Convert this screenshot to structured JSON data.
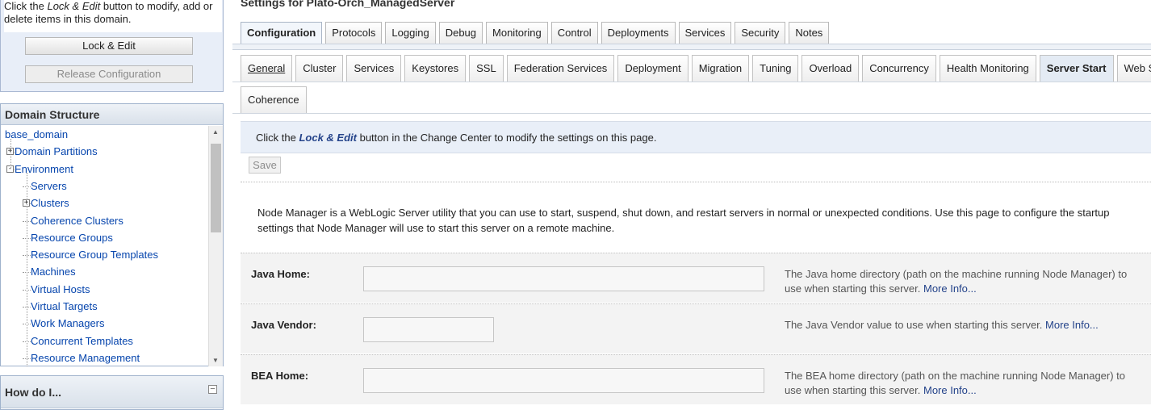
{
  "change_center": {
    "message_prefix": "Click the ",
    "message_emph": "Lock & Edit",
    "message_suffix": " button to modify, add or delete items in this domain.",
    "lock_edit_label": "Lock & Edit",
    "release_config_label": "Release Configuration"
  },
  "domain_structure": {
    "title": "Domain Structure",
    "tree": [
      {
        "label": "base_domain",
        "level": 0,
        "toggle": ""
      },
      {
        "label": "Domain Partitions",
        "level": 1,
        "toggle": "+"
      },
      {
        "label": "Environment",
        "level": 1,
        "toggle": "-"
      },
      {
        "label": "Servers",
        "level": 2,
        "toggle": ""
      },
      {
        "label": "Clusters",
        "level": 2,
        "toggle": "+"
      },
      {
        "label": "Coherence Clusters",
        "level": 2,
        "toggle": ""
      },
      {
        "label": "Resource Groups",
        "level": 2,
        "toggle": ""
      },
      {
        "label": "Resource Group Templates",
        "level": 2,
        "toggle": ""
      },
      {
        "label": "Machines",
        "level": 2,
        "toggle": ""
      },
      {
        "label": "Virtual Hosts",
        "level": 2,
        "toggle": ""
      },
      {
        "label": "Virtual Targets",
        "level": 2,
        "toggle": ""
      },
      {
        "label": "Work Managers",
        "level": 2,
        "toggle": ""
      },
      {
        "label": "Concurrent Templates",
        "level": 2,
        "toggle": ""
      },
      {
        "label": "Resource Management",
        "level": 2,
        "toggle": ""
      }
    ]
  },
  "how_do_i": {
    "title": "How do I..."
  },
  "main": {
    "settings_title": "Settings for Plato-Orch_ManagedServer",
    "top_tabs": [
      "Configuration",
      "Protocols",
      "Logging",
      "Debug",
      "Monitoring",
      "Control",
      "Deployments",
      "Services",
      "Security",
      "Notes"
    ],
    "top_tab_active": "Configuration",
    "sub_tabs_row1": [
      "General",
      "Cluster",
      "Services",
      "Keystores",
      "SSL",
      "Federation Services",
      "Deployment",
      "Migration",
      "Tuning",
      "Overload",
      "Concurrency",
      "Health Monitoring",
      "Server Start",
      "Web Services"
    ],
    "sub_tabs_row2": [
      "Coherence"
    ],
    "sub_tab_active": "Server Start",
    "info_prefix": "Click the ",
    "info_emph": "Lock & Edit",
    "info_suffix": " button in the Change Center to modify the settings on this page.",
    "save_label": "Save",
    "description": "Node Manager is a WebLogic Server utility that you can use to start, suspend, shut down, and restart servers in normal or unexpected conditions. Use this page to configure the startup settings that Node Manager will use to start this server on a remote machine.",
    "fields": [
      {
        "label": "Java Home:",
        "value": "",
        "help": "The Java home directory (path on the machine running Node Manager) to use when starting this server.",
        "more": "More Info..."
      },
      {
        "label": "Java Vendor:",
        "value": "",
        "help": "The Java Vendor value to use when starting this server.",
        "more": "More Info..."
      },
      {
        "label": "BEA Home:",
        "value": "",
        "help": "The BEA home directory (path on the machine running Node Manager) to use when starting this server.",
        "more": "More Info..."
      }
    ]
  }
}
